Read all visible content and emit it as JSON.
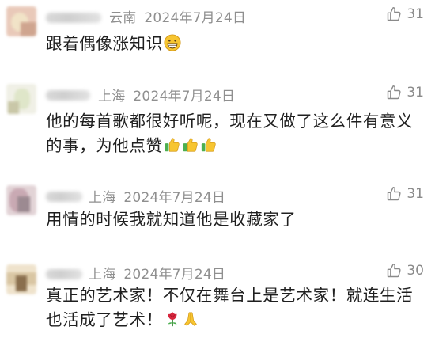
{
  "comments": [
    {
      "location": "云南",
      "date": "2024年7月24日",
      "likes": "31",
      "text": "跟着偶像涨知识",
      "emojis": [
        "grinning-face-emoji"
      ],
      "avatar_colors": [
        "#e9c9b9",
        "#f1e3c7",
        "#cfa58f"
      ]
    },
    {
      "location": "上海",
      "date": "2024年7月24日",
      "likes": "31",
      "text": "他的每首歌都很好听呢，现在又做了这么件有意义的事，为他点赞",
      "emojis": [
        "thumbs-up-emoji",
        "thumbs-up-emoji",
        "thumbs-up-emoji"
      ],
      "avatar_colors": [
        "#f0f0e6",
        "#dfe6c9",
        "#c9c7a8"
      ]
    },
    {
      "location": "上海",
      "date": "2024年7月24日",
      "likes": "31",
      "text": "用情的时候我就知道他是收藏家了",
      "emojis": [],
      "avatar_colors": [
        "#c9a9b3",
        "#9c8a91",
        "#e2d3d6"
      ]
    },
    {
      "location": "上海",
      "date": "2024年7月24日",
      "likes": "30",
      "text": "真正的艺术家！不仅在舞台上是艺术家！就连生活也活成了艺术！",
      "emojis": [
        "rose-emoji",
        "folded-hands-emoji"
      ],
      "avatar_colors": [
        "#d9c6a3",
        "#8a6f4e",
        "#efe3cc"
      ]
    }
  ]
}
